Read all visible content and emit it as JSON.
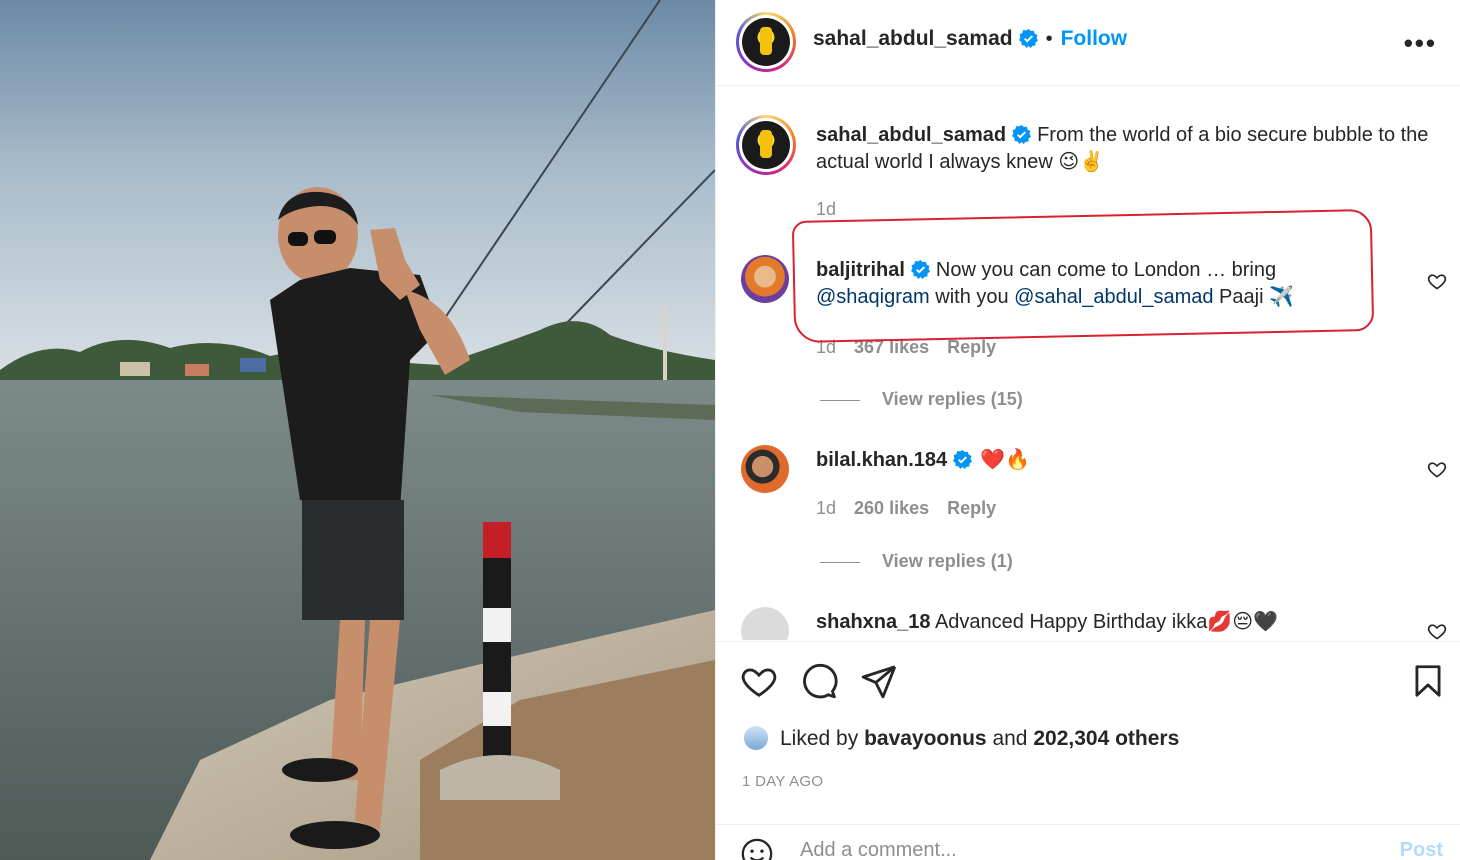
{
  "post": {
    "author": "sahal_abdul_samad",
    "follow_label": "Follow",
    "dot": "•",
    "more_label": "•••",
    "caption_text": "From the world of a bio secure bubble to the actual world I always knew 😉✌️",
    "caption_time": "1d"
  },
  "comments": [
    {
      "user": "baljitrihal",
      "verified": true,
      "text_before": "Now you can come to London … bring ",
      "mention1": "@shaqigram",
      "text_mid": " with you ",
      "mention2": "@sahal_abdul_samad",
      "text_after": " Paaji ✈️",
      "time": "1d",
      "likes": "367 likes",
      "reply_label": "Reply",
      "view_replies": "View replies (15)"
    },
    {
      "user": "bilal.khan.184",
      "verified": true,
      "text": "❤️🔥",
      "time": "1d",
      "likes": "260 likes",
      "reply_label": "Reply",
      "view_replies": "View replies (1)"
    },
    {
      "user": "shahxna_18",
      "verified": false,
      "text": "Advanced Happy Birthday ikka💋😔🖤"
    }
  ],
  "engagement": {
    "liked_by_prefix": "Liked by",
    "liked_by_user": "bavayoonus",
    "liked_by_and": "and",
    "liked_by_others": "202,304 others",
    "time_ago": "1 DAY AGO"
  },
  "comment_box": {
    "placeholder": "Add a comment...",
    "post_label": "Post"
  },
  "colors": {
    "link_blue": "#0095f6",
    "mention": "#00376b",
    "highlight_red": "#d8222f",
    "muted": "#8e8e8e"
  },
  "icons": [
    "verified-badge-icon",
    "more-options-icon",
    "heart-icon",
    "comment-icon",
    "share-icon",
    "bookmark-icon",
    "emoji-icon"
  ]
}
